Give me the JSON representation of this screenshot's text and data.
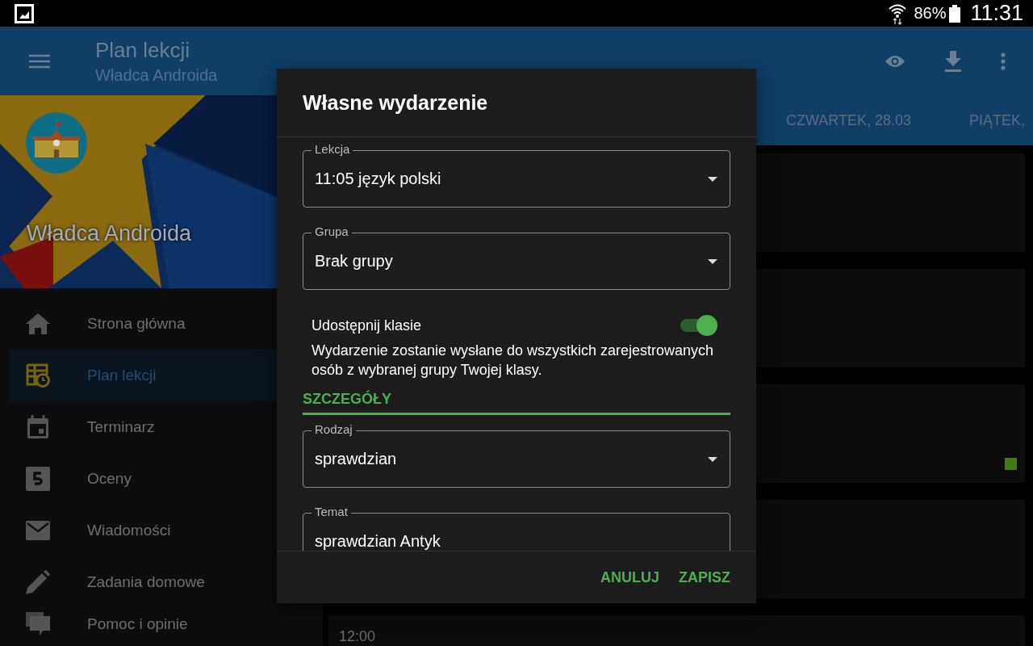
{
  "status_bar": {
    "battery": "86%",
    "time": "11:31"
  },
  "app_bar": {
    "title": "Plan lekcji",
    "subtitle": "Władca Androida"
  },
  "drawer": {
    "header_name": "Władca Androida",
    "items": [
      {
        "label": "Strona główna",
        "kind": "home",
        "selected": false
      },
      {
        "label": "Plan lekcji",
        "kind": "timetable",
        "selected": true
      },
      {
        "label": "Terminarz",
        "kind": "calendar",
        "selected": false
      },
      {
        "label": "Oceny",
        "kind": "grade",
        "selected": false
      },
      {
        "label": "Wiadomości",
        "kind": "mail",
        "selected": false
      },
      {
        "label": "Zadania domowe",
        "kind": "pen",
        "selected": false
      },
      {
        "label": "Pomoc i opinie",
        "kind": "chat",
        "selected": false
      }
    ]
  },
  "tabs": [
    {
      "label": "CZWARTEK, 28.03",
      "selected": false
    },
    {
      "label": "PIĄTEK,",
      "selected": false
    }
  ],
  "cards": [
    {
      "kind": "blank"
    },
    {
      "kind": "blank"
    },
    {
      "kind": "marked"
    },
    {
      "kind": "blank"
    },
    {
      "kind": "time",
      "time": "12:00"
    }
  ],
  "dialog": {
    "title": "Własne wydarzenie",
    "fields": [
      {
        "label": "Lekcja",
        "value": "11:05 język polski",
        "kind": "dropdown"
      },
      {
        "label": "Grupa",
        "value": "Brak grupy",
        "kind": "dropdown"
      }
    ],
    "share": {
      "label": "Udostępnij klasie",
      "on": true,
      "description": "Wydarzenie zostanie wysłane do wszystkich zarejestrowanych osób z wybranej grupy Twojej klasy."
    },
    "section": "SZCZEGÓŁY",
    "details": [
      {
        "label": "Rodzaj",
        "value": "sprawdzian",
        "kind": "dropdown"
      },
      {
        "label": "Temat",
        "value": "sprawdzian Antyk",
        "kind": "text"
      }
    ],
    "buttons": [
      "ANULUJ",
      "ZAPISZ"
    ]
  }
}
